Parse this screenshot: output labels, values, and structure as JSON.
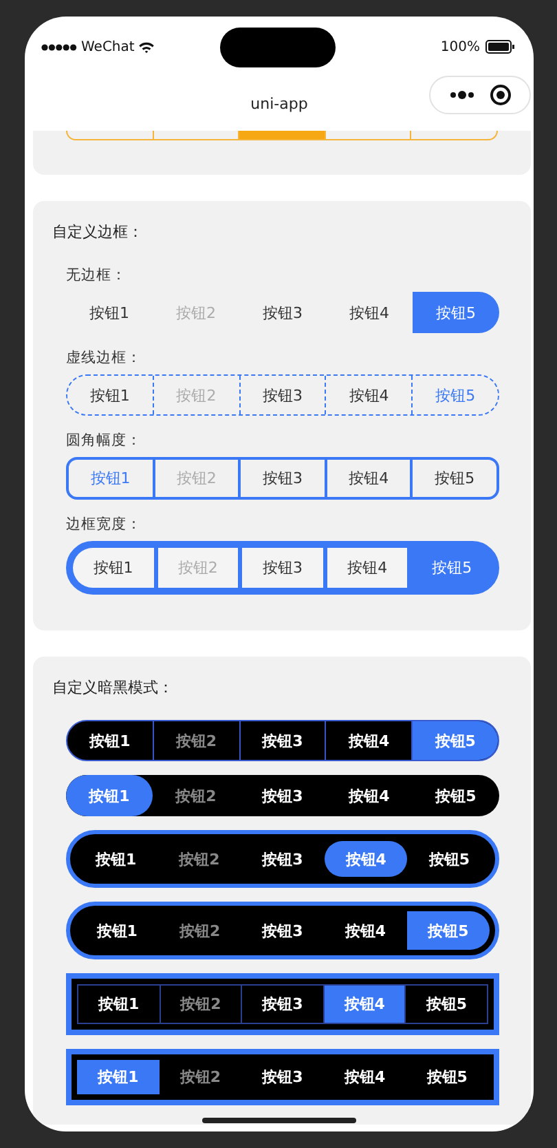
{
  "status_bar": {
    "carrier": "WeChat",
    "battery": "100%"
  },
  "nav_bar": {
    "title": "uni-app"
  },
  "top_partial": {
    "items": [
      {
        "selected": false
      },
      {
        "selected": false
      },
      {
        "selected": true
      },
      {
        "selected": false
      },
      {
        "selected": false
      }
    ]
  },
  "cards": [
    {
      "title": "自定义边框：",
      "groups": [
        {
          "label": "无边框：",
          "kind": "plain",
          "items": [
            {
              "label": "按钮1",
              "selected": false,
              "disabled": false
            },
            {
              "label": "按钮2",
              "selected": false,
              "disabled": true
            },
            {
              "label": "按钮3",
              "selected": false,
              "disabled": false
            },
            {
              "label": "按钮4",
              "selected": false,
              "disabled": false
            },
            {
              "label": "按钮5",
              "selected": true,
              "disabled": false
            }
          ]
        },
        {
          "label": "虚线边框：",
          "kind": "dashed",
          "items": [
            {
              "label": "按钮1",
              "selected": false,
              "disabled": false
            },
            {
              "label": "按钮2",
              "selected": false,
              "disabled": true
            },
            {
              "label": "按钮3",
              "selected": false,
              "disabled": false
            },
            {
              "label": "按钮4",
              "selected": false,
              "disabled": false
            },
            {
              "label": "按钮5",
              "selected": true,
              "disabled": false
            }
          ]
        },
        {
          "label": "圆角幅度：",
          "kind": "rounded",
          "items": [
            {
              "label": "按钮1",
              "selected": true,
              "disabled": false
            },
            {
              "label": "按钮2",
              "selected": false,
              "disabled": true
            },
            {
              "label": "按钮3",
              "selected": false,
              "disabled": false
            },
            {
              "label": "按钮4",
              "selected": false,
              "disabled": false
            },
            {
              "label": "按钮5",
              "selected": false,
              "disabled": false
            }
          ]
        },
        {
          "label": "边框宽度：",
          "kind": "thick",
          "items": [
            {
              "label": "按钮1",
              "selected": false,
              "disabled": false
            },
            {
              "label": "按钮2",
              "selected": false,
              "disabled": true
            },
            {
              "label": "按钮3",
              "selected": false,
              "disabled": false
            },
            {
              "label": "按钮4",
              "selected": false,
              "disabled": false
            },
            {
              "label": "按钮5",
              "selected": true,
              "disabled": false
            }
          ]
        }
      ]
    },
    {
      "title": "自定义暗黑模式：",
      "groups": [
        {
          "kind": "dark_divided",
          "items": [
            {
              "label": "按钮1",
              "selected": false,
              "disabled": false
            },
            {
              "label": "按钮2",
              "selected": false,
              "disabled": true
            },
            {
              "label": "按钮3",
              "selected": false,
              "disabled": false
            },
            {
              "label": "按钮4",
              "selected": false,
              "disabled": false
            },
            {
              "label": "按钮5",
              "selected": true,
              "disabled": false
            }
          ]
        },
        {
          "kind": "dark_pill",
          "items": [
            {
              "label": "按钮1",
              "selected": true,
              "disabled": false
            },
            {
              "label": "按钮2",
              "selected": false,
              "disabled": true
            },
            {
              "label": "按钮3",
              "selected": false,
              "disabled": false
            },
            {
              "label": "按钮4",
              "selected": false,
              "disabled": false
            },
            {
              "label": "按钮5",
              "selected": false,
              "disabled": false
            }
          ]
        },
        {
          "kind": "dark_outline_pill",
          "items": [
            {
              "label": "按钮1",
              "selected": false,
              "disabled": false
            },
            {
              "label": "按钮2",
              "selected": false,
              "disabled": true
            },
            {
              "label": "按钮3",
              "selected": false,
              "disabled": false
            },
            {
              "label": "按钮4",
              "selected": true,
              "disabled": false
            },
            {
              "label": "按钮5",
              "selected": false,
              "disabled": false
            }
          ]
        },
        {
          "kind": "dark_outline_tab",
          "items": [
            {
              "label": "按钮1",
              "selected": false,
              "disabled": false
            },
            {
              "label": "按钮2",
              "selected": false,
              "disabled": true
            },
            {
              "label": "按钮3",
              "selected": false,
              "disabled": false
            },
            {
              "label": "按钮4",
              "selected": false,
              "disabled": false
            },
            {
              "label": "按钮5",
              "selected": true,
              "disabled": false
            }
          ]
        },
        {
          "kind": "dark_box_grid",
          "items": [
            {
              "label": "按钮1",
              "selected": false,
              "disabled": false
            },
            {
              "label": "按钮2",
              "selected": false,
              "disabled": true
            },
            {
              "label": "按钮3",
              "selected": false,
              "disabled": false
            },
            {
              "label": "按钮4",
              "selected": true,
              "disabled": false
            },
            {
              "label": "按钮5",
              "selected": false,
              "disabled": false
            }
          ]
        },
        {
          "kind": "dark_box",
          "items": [
            {
              "label": "按钮1",
              "selected": true,
              "disabled": false
            },
            {
              "label": "按钮2",
              "selected": false,
              "disabled": true
            },
            {
              "label": "按钮3",
              "selected": false,
              "disabled": false
            },
            {
              "label": "按钮4",
              "selected": false,
              "disabled": false
            },
            {
              "label": "按钮5",
              "selected": false,
              "disabled": false
            }
          ]
        }
      ]
    }
  ]
}
